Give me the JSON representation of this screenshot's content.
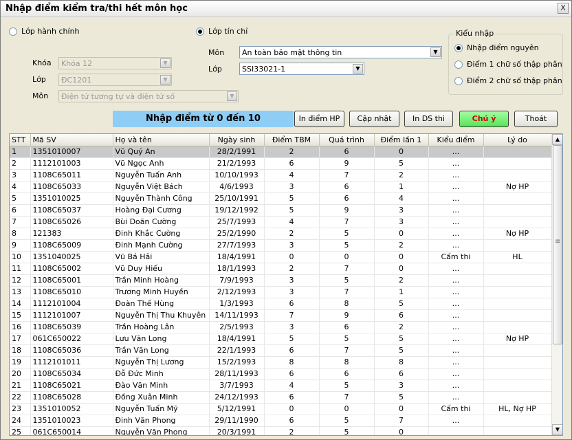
{
  "window": {
    "title": "Nhập điểm kiểm tra/thi hết môn học",
    "close_label": "X"
  },
  "options": {
    "lop_hanh_chinh": {
      "label": "Lớp hành chính",
      "checked": false
    },
    "lop_tin_chi": {
      "label": "Lớp tín chỉ",
      "checked": true
    }
  },
  "admin_class": {
    "khoa_label": "Khóa",
    "khoa_value": "Khóa 12",
    "lop_label": "Lớp",
    "lop_value": "ĐC1201",
    "mon_label": "Môn",
    "mon_value": "Điện tử tương tự và điện tử số"
  },
  "credit_class": {
    "mon_label": "Môn",
    "mon_value": "An toàn bảo mật thông tin",
    "lop_label": "Lớp",
    "lop_value": "SSI33021-1"
  },
  "input_type": {
    "title": "Kiểu nhập",
    "options": [
      {
        "label": "Nhập điểm nguyên",
        "checked": true
      },
      {
        "label": "Điểm 1 chữ số thập phân",
        "checked": false
      },
      {
        "label": "Điểm 2 chữ số thập phân",
        "checked": false
      }
    ]
  },
  "banner": "Nhập điểm từ 0 đến 10",
  "buttons": {
    "print_hp": "In điểm HP",
    "update": "Cập nhật",
    "print_ds": "In DS thi",
    "note": "Chú ý",
    "exit": "Thoát"
  },
  "table": {
    "columns": [
      "STT",
      "Mã SV",
      "Họ và tên",
      "Ngày sinh",
      "Điểm TBM",
      "Quá trình",
      "Điểm lần 1",
      "Kiểu điểm",
      "Lý do"
    ],
    "rows": [
      [
        "1",
        "1351010007",
        "Vũ Quý An",
        "28/2/1991",
        "2",
        "6",
        "0",
        "...",
        ""
      ],
      [
        "2",
        "1112101003",
        "Vũ Ngọc Anh",
        "21/2/1993",
        "6",
        "9",
        "5",
        "...",
        ""
      ],
      [
        "3",
        "1108C65011",
        "Nguyễn Tuấn Anh",
        "10/10/1993",
        "4",
        "7",
        "2",
        "...",
        ""
      ],
      [
        "4",
        "1108C65033",
        "Nguyễn Việt Bách",
        "4/6/1993",
        "3",
        "6",
        "1",
        "...",
        "Nợ HP"
      ],
      [
        "5",
        "1351010025",
        "Nguyễn Thành Công",
        "25/10/1991",
        "5",
        "6",
        "4",
        "...",
        ""
      ],
      [
        "6",
        "1108C65037",
        "Hoàng Đại Cương",
        "19/12/1992",
        "5",
        "9",
        "3",
        "...",
        ""
      ],
      [
        "7",
        "1108C65026",
        "Bùi Doãn Cường",
        "25/7/1993",
        "4",
        "7",
        "3",
        "...",
        ""
      ],
      [
        "8",
        "121383",
        "Đinh Khắc Cường",
        "25/2/1990",
        "2",
        "5",
        "0",
        "...",
        "Nợ HP"
      ],
      [
        "9",
        "1108C65009",
        "Đinh Mạnh Cường",
        "27/7/1993",
        "3",
        "5",
        "2",
        "...",
        ""
      ],
      [
        "10",
        "1351040025",
        "Vũ Bá Hải",
        "18/4/1991",
        "0",
        "0",
        "0",
        "Cấm thi",
        "HL"
      ],
      [
        "11",
        "1108C65002",
        "Vũ Duy Hiếu",
        "18/1/1993",
        "2",
        "7",
        "0",
        "...",
        ""
      ],
      [
        "12",
        "1108C65001",
        "Trần Minh Hoàng",
        "7/9/1993",
        "3",
        "5",
        "2",
        "...",
        ""
      ],
      [
        "13",
        "1108C65010",
        "Trương Minh Huyền",
        "2/12/1993",
        "3",
        "7",
        "1",
        "...",
        ""
      ],
      [
        "14",
        "1112101004",
        "Đoàn Thế Hùng",
        "1/3/1993",
        "6",
        "8",
        "5",
        "...",
        ""
      ],
      [
        "15",
        "1112101007",
        "Nguyễn Thị Thu Khuyên",
        "14/11/1993",
        "7",
        "9",
        "6",
        "...",
        ""
      ],
      [
        "16",
        "1108C65039",
        "Trần Hoàng Lân",
        "2/5/1993",
        "3",
        "6",
        "2",
        "...",
        ""
      ],
      [
        "17",
        "061C650022",
        "Lưu Văn Long",
        "18/4/1991",
        "5",
        "5",
        "5",
        "...",
        "Nợ HP"
      ],
      [
        "18",
        "1108C65036",
        "Trần Văn Long",
        "22/1/1993",
        "6",
        "7",
        "5",
        "...",
        ""
      ],
      [
        "19",
        "1112101011",
        "Nguyễn Thị Lương",
        "15/2/1993",
        "8",
        "8",
        "8",
        "...",
        ""
      ],
      [
        "20",
        "1108C65034",
        "Đỗ Đức Minh",
        "28/11/1993",
        "6",
        "6",
        "6",
        "...",
        ""
      ],
      [
        "21",
        "1108C65021",
        "Đào Văn Minh",
        "3/7/1993",
        "4",
        "5",
        "3",
        "...",
        ""
      ],
      [
        "22",
        "1108C65028",
        "Đồng Xuân Minh",
        "24/12/1993",
        "6",
        "7",
        "5",
        "...",
        ""
      ],
      [
        "23",
        "1351010052",
        "Nguyễn Tuấn Mỹ",
        "5/12/1991",
        "0",
        "0",
        "0",
        "Cấm thi",
        "HL, Nợ HP"
      ],
      [
        "24",
        "1351010023",
        "Đinh Văn Phong",
        "29/11/1990",
        "6",
        "5",
        "7",
        "...",
        ""
      ],
      [
        "25",
        "061C650014",
        "Nguyễn Văn Phong",
        "20/3/1991",
        "2",
        "5",
        "0",
        "",
        ""
      ]
    ]
  }
}
